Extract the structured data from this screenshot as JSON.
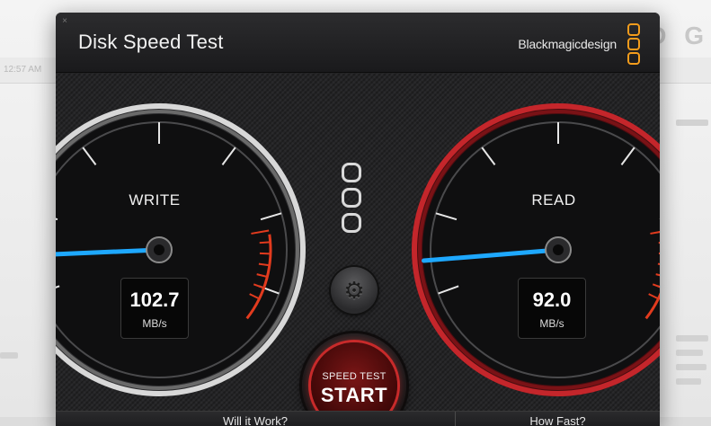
{
  "window": {
    "title": "Disk Speed Test",
    "close_icon": "close-icon",
    "brand": "Blackmagicdesign",
    "brand_color": "#f39c1c"
  },
  "gauges": {
    "write": {
      "label": "WRITE",
      "value": "102.7",
      "unit": "MB/s",
      "needle_level": 0.08,
      "accent": "#1ea8ff"
    },
    "read": {
      "label": "READ",
      "value": "92.0",
      "unit": "MB/s",
      "needle_level": 0.07,
      "accent": "#1ea8ff",
      "rim_color": "#c4262b"
    }
  },
  "controls": {
    "settings_icon": "gear-icon",
    "start_small": "SPEED TEST",
    "start_big": "START",
    "start_glow": "#d42b2b"
  },
  "footer": {
    "will_it_work": "Will it Work?",
    "how_fast": "How Fast?"
  },
  "background": {
    "stamp": "12:57 AM",
    "glyph": "D G"
  }
}
